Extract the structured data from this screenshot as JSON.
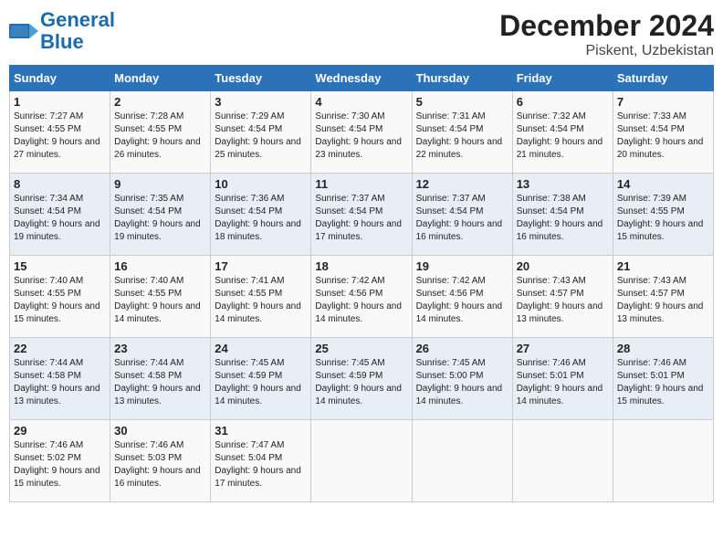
{
  "logo": {
    "name_part1": "General",
    "name_part2": "Blue"
  },
  "title": {
    "month_year": "December 2024",
    "location": "Piskent, Uzbekistan"
  },
  "headers": [
    "Sunday",
    "Monday",
    "Tuesday",
    "Wednesday",
    "Thursday",
    "Friday",
    "Saturday"
  ],
  "weeks": [
    [
      {
        "day": "1",
        "sunrise": "7:27 AM",
        "sunset": "4:55 PM",
        "daylight_hours": "9",
        "daylight_minutes": "27"
      },
      {
        "day": "2",
        "sunrise": "7:28 AM",
        "sunset": "4:55 PM",
        "daylight_hours": "9",
        "daylight_minutes": "26"
      },
      {
        "day": "3",
        "sunrise": "7:29 AM",
        "sunset": "4:54 PM",
        "daylight_hours": "9",
        "daylight_minutes": "25"
      },
      {
        "day": "4",
        "sunrise": "7:30 AM",
        "sunset": "4:54 PM",
        "daylight_hours": "9",
        "daylight_minutes": "23"
      },
      {
        "day": "5",
        "sunrise": "7:31 AM",
        "sunset": "4:54 PM",
        "daylight_hours": "9",
        "daylight_minutes": "22"
      },
      {
        "day": "6",
        "sunrise": "7:32 AM",
        "sunset": "4:54 PM",
        "daylight_hours": "9",
        "daylight_minutes": "21"
      },
      {
        "day": "7",
        "sunrise": "7:33 AM",
        "sunset": "4:54 PM",
        "daylight_hours": "9",
        "daylight_minutes": "20"
      }
    ],
    [
      {
        "day": "8",
        "sunrise": "7:34 AM",
        "sunset": "4:54 PM",
        "daylight_hours": "9",
        "daylight_minutes": "19"
      },
      {
        "day": "9",
        "sunrise": "7:35 AM",
        "sunset": "4:54 PM",
        "daylight_hours": "9",
        "daylight_minutes": "19"
      },
      {
        "day": "10",
        "sunrise": "7:36 AM",
        "sunset": "4:54 PM",
        "daylight_hours": "9",
        "daylight_minutes": "18"
      },
      {
        "day": "11",
        "sunrise": "7:37 AM",
        "sunset": "4:54 PM",
        "daylight_hours": "9",
        "daylight_minutes": "17"
      },
      {
        "day": "12",
        "sunrise": "7:37 AM",
        "sunset": "4:54 PM",
        "daylight_hours": "9",
        "daylight_minutes": "16"
      },
      {
        "day": "13",
        "sunrise": "7:38 AM",
        "sunset": "4:54 PM",
        "daylight_hours": "9",
        "daylight_minutes": "16"
      },
      {
        "day": "14",
        "sunrise": "7:39 AM",
        "sunset": "4:55 PM",
        "daylight_hours": "9",
        "daylight_minutes": "15"
      }
    ],
    [
      {
        "day": "15",
        "sunrise": "7:40 AM",
        "sunset": "4:55 PM",
        "daylight_hours": "9",
        "daylight_minutes": "15"
      },
      {
        "day": "16",
        "sunrise": "7:40 AM",
        "sunset": "4:55 PM",
        "daylight_hours": "9",
        "daylight_minutes": "14"
      },
      {
        "day": "17",
        "sunrise": "7:41 AM",
        "sunset": "4:55 PM",
        "daylight_hours": "9",
        "daylight_minutes": "14"
      },
      {
        "day": "18",
        "sunrise": "7:42 AM",
        "sunset": "4:56 PM",
        "daylight_hours": "9",
        "daylight_minutes": "14"
      },
      {
        "day": "19",
        "sunrise": "7:42 AM",
        "sunset": "4:56 PM",
        "daylight_hours": "9",
        "daylight_minutes": "14"
      },
      {
        "day": "20",
        "sunrise": "7:43 AM",
        "sunset": "4:57 PM",
        "daylight_hours": "9",
        "daylight_minutes": "13"
      },
      {
        "day": "21",
        "sunrise": "7:43 AM",
        "sunset": "4:57 PM",
        "daylight_hours": "9",
        "daylight_minutes": "13"
      }
    ],
    [
      {
        "day": "22",
        "sunrise": "7:44 AM",
        "sunset": "4:58 PM",
        "daylight_hours": "9",
        "daylight_minutes": "13"
      },
      {
        "day": "23",
        "sunrise": "7:44 AM",
        "sunset": "4:58 PM",
        "daylight_hours": "9",
        "daylight_minutes": "13"
      },
      {
        "day": "24",
        "sunrise": "7:45 AM",
        "sunset": "4:59 PM",
        "daylight_hours": "9",
        "daylight_minutes": "14"
      },
      {
        "day": "25",
        "sunrise": "7:45 AM",
        "sunset": "4:59 PM",
        "daylight_hours": "9",
        "daylight_minutes": "14"
      },
      {
        "day": "26",
        "sunrise": "7:45 AM",
        "sunset": "5:00 PM",
        "daylight_hours": "9",
        "daylight_minutes": "14"
      },
      {
        "day": "27",
        "sunrise": "7:46 AM",
        "sunset": "5:01 PM",
        "daylight_hours": "9",
        "daylight_minutes": "14"
      },
      {
        "day": "28",
        "sunrise": "7:46 AM",
        "sunset": "5:01 PM",
        "daylight_hours": "9",
        "daylight_minutes": "15"
      }
    ],
    [
      {
        "day": "29",
        "sunrise": "7:46 AM",
        "sunset": "5:02 PM",
        "daylight_hours": "9",
        "daylight_minutes": "15"
      },
      {
        "day": "30",
        "sunrise": "7:46 AM",
        "sunset": "5:03 PM",
        "daylight_hours": "9",
        "daylight_minutes": "16"
      },
      {
        "day": "31",
        "sunrise": "7:47 AM",
        "sunset": "5:04 PM",
        "daylight_hours": "9",
        "daylight_minutes": "17"
      },
      null,
      null,
      null,
      null
    ]
  ],
  "labels": {
    "sunrise": "Sunrise:",
    "sunset": "Sunset:",
    "daylight": "Daylight:"
  }
}
